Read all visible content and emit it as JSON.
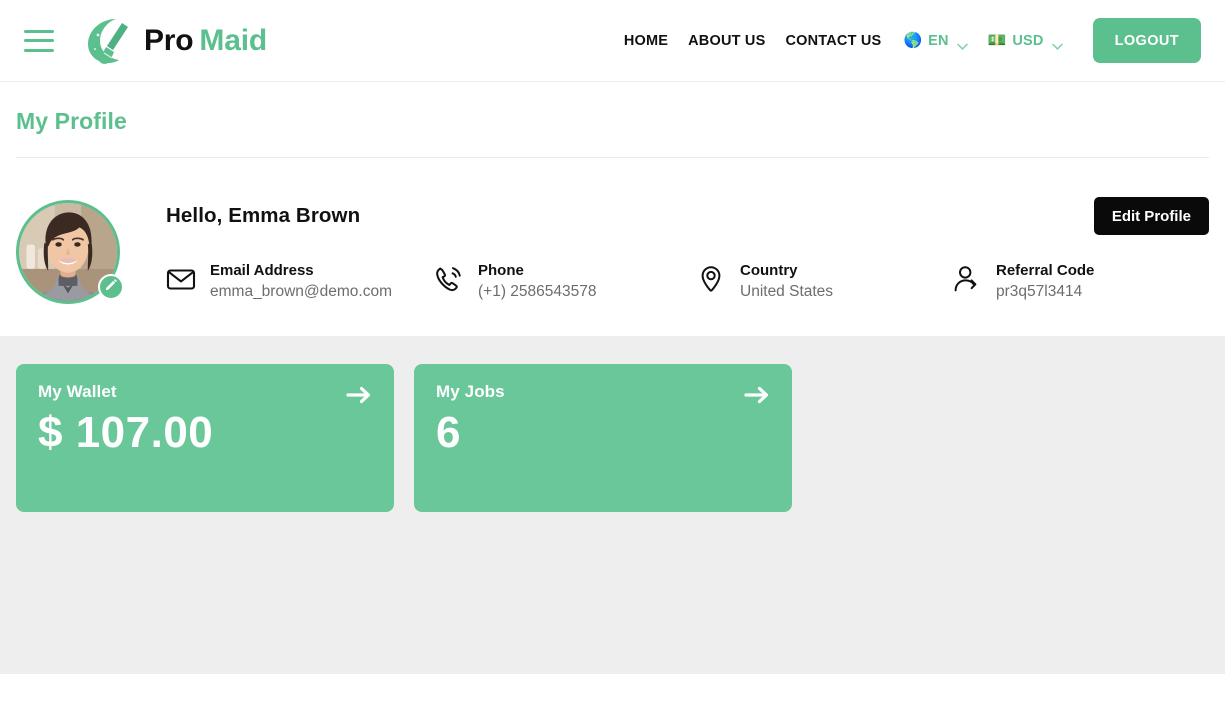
{
  "header": {
    "menu_icon": "hamburger-icon",
    "brand": {
      "logo_icon": "broom-logo-icon",
      "name_first": "Pro",
      "name_second": "Maid"
    },
    "nav_links": [
      {
        "label": "HOME"
      },
      {
        "label": "ABOUT US"
      },
      {
        "label": "CONTACT US"
      }
    ],
    "language_selector": {
      "flag_icon": "globe-icon",
      "flag_glyph": "🌎",
      "code": "EN",
      "chevron_icon": "chevron-down-icon"
    },
    "currency_selector": {
      "flag_icon": "banknote-icon",
      "flag_glyph": "💵",
      "code": "USD",
      "chevron_icon": "chevron-down-icon"
    },
    "logout_label": "LOGOUT"
  },
  "page": {
    "title": "My Profile"
  },
  "profile": {
    "avatar_alt": "user-avatar-photo",
    "edit_avatar_icon": "pencil-icon",
    "greeting": "Hello, Emma Brown",
    "edit_profile_label": "Edit Profile",
    "info": [
      {
        "icon": "envelope-icon",
        "label": "Email Address",
        "value": "emma_brown@demo.com"
      },
      {
        "icon": "phone-ring-icon",
        "label": "Phone",
        "value": "(+1) 2586543578"
      },
      {
        "icon": "map-pin-icon",
        "label": "Country",
        "value": "United States"
      },
      {
        "icon": "user-share-icon",
        "label": "Referral Code",
        "value": "pr3q57l3414"
      }
    ]
  },
  "stats": [
    {
      "label": "My Wallet",
      "value": "$ 107.00",
      "arrow_icon": "arrow-right-icon"
    },
    {
      "label": "My Jobs",
      "value": "6",
      "arrow_icon": "arrow-right-icon"
    }
  ],
  "colors": {
    "brand_green": "#5cc08e",
    "card_green": "#69c79a",
    "stats_bg": "#eeeeee",
    "dark_button": "#0a0a0a",
    "text_dark": "#111111",
    "text_muted": "#6d6d6d"
  }
}
